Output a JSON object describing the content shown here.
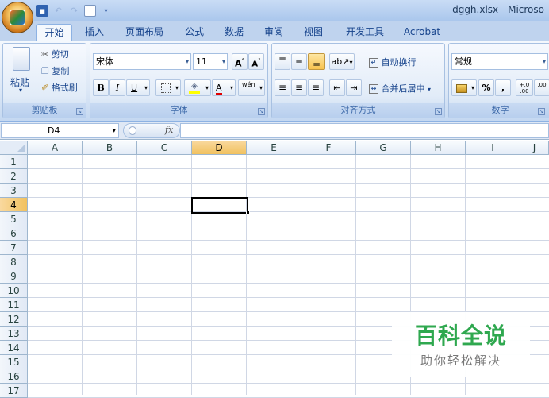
{
  "window": {
    "title": "dggh.xlsx - Microso"
  },
  "tabs": [
    {
      "label": "开始",
      "active": true
    },
    {
      "label": "插入"
    },
    {
      "label": "页面布局"
    },
    {
      "label": "公式"
    },
    {
      "label": "数据"
    },
    {
      "label": "审阅"
    },
    {
      "label": "视图"
    },
    {
      "label": "开发工具"
    },
    {
      "label": "Acrobat"
    }
  ],
  "clipboard": {
    "paste": "粘贴",
    "cut": "剪切",
    "copy": "复制",
    "format_painter": "格式刷",
    "group_label": "剪贴板"
  },
  "font": {
    "name": "宋体",
    "size": "11",
    "bold": "B",
    "italic": "I",
    "underline": "U",
    "grow": "A",
    "shrink": "A",
    "font_color": "A",
    "phonetic": "wén",
    "group_label": "字体"
  },
  "alignment": {
    "wrap_text": "自动换行",
    "merge_center": "合并后居中",
    "group_label": "对齐方式"
  },
  "number": {
    "format": "常规",
    "percent": "%",
    "comma": ",",
    "inc_decimal": "+.0\n.00",
    "dec_decimal": ".00",
    "group_label": "数字"
  },
  "formula_bar": {
    "name_box": "D4",
    "fx": "fx",
    "content": ""
  },
  "columns": [
    "A",
    "B",
    "C",
    "D",
    "E",
    "F",
    "G",
    "H",
    "I",
    "J"
  ],
  "rows": [
    "1",
    "2",
    "3",
    "4",
    "5",
    "6",
    "7",
    "8",
    "9",
    "10",
    "11",
    "12",
    "13",
    "14",
    "15",
    "16",
    "17"
  ],
  "selection": {
    "column": "D",
    "row": "4"
  },
  "watermark": {
    "title": "百科全说",
    "subtitle": "助你轻松解决"
  }
}
